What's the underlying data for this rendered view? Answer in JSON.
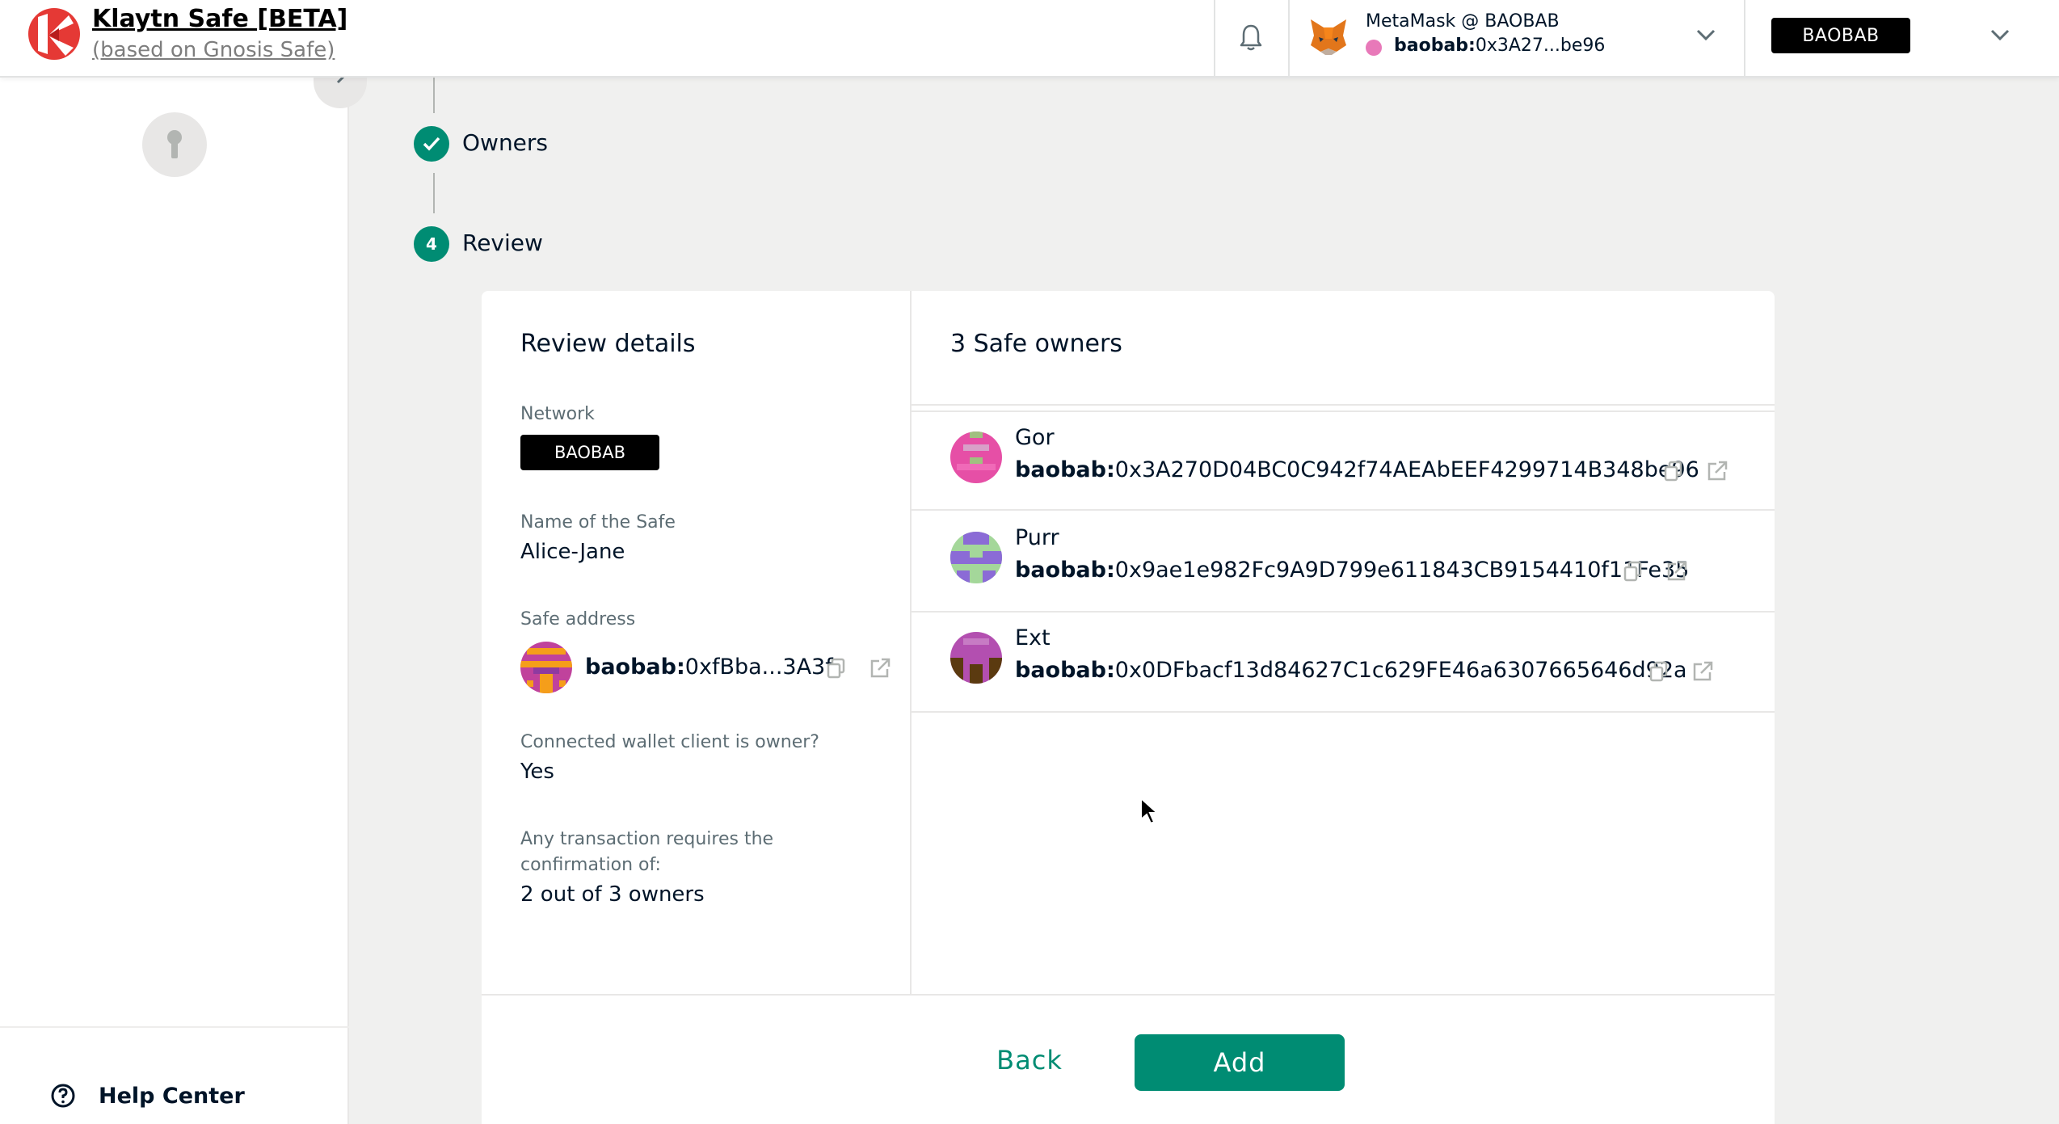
{
  "header": {
    "title": "Klaytn Safe [BETA]",
    "subtitle": "(based on Gnosis Safe)",
    "wallet": {
      "provider": "MetaMask @ BAOBAB",
      "address_prefix": "baobab:",
      "address_short": "0x3A27...be96"
    },
    "network": "BAOBAB",
    "icons": [
      "bell-icon",
      "metamask-fox-icon",
      "chevron-down-icon"
    ]
  },
  "sidebar": {
    "help_label": "Help Center"
  },
  "stepper": {
    "steps": [
      {
        "label": "Owners",
        "state": "done"
      },
      {
        "number": "4",
        "label": "Review",
        "state": "active"
      }
    ]
  },
  "review": {
    "title": "Review details",
    "network_label": "Network",
    "network_value": "BAOBAB",
    "name_label": "Name of the Safe",
    "name_value": "Alice-Jane",
    "address_label": "Safe address",
    "address_prefix": "baobab:",
    "address_value": "0xfBba...3A3f",
    "owner_q_label": "Connected wallet client is owner?",
    "owner_q_value": "Yes",
    "threshold_label_1": "Any transaction requires the",
    "threshold_label_2": "confirmation of:",
    "threshold_value": "2 out of 3 owners"
  },
  "owners": {
    "title": "3 Safe owners",
    "list": [
      {
        "name": "Gor",
        "prefix": "baobab:",
        "address": "0x3A270D04BC0C942f74AEAbEEF4299714B348be96"
      },
      {
        "name": "Purr",
        "prefix": "baobab:",
        "address": "0x9ae1e982Fc9A9D799e611843CB9154410f11Fe35"
      },
      {
        "name": "Ext",
        "prefix": "baobab:",
        "address": "0x0DFbacf13d84627C1c629FE46a6307665646d92a"
      }
    ]
  },
  "footer": {
    "back_label": "Back",
    "add_label": "Add"
  },
  "colors": {
    "primary": "#008c73",
    "network_pill": "#000000",
    "page_bg": "#f0f0ef"
  }
}
